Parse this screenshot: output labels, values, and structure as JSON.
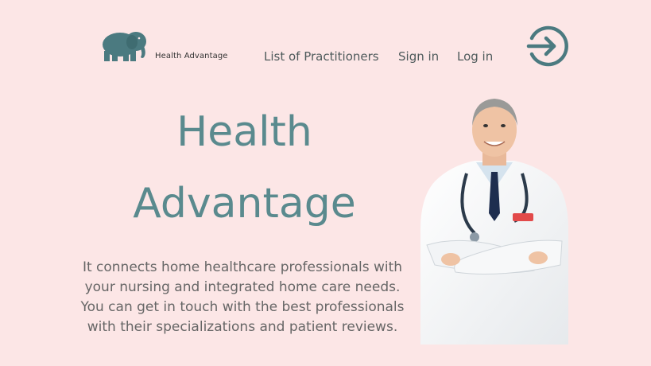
{
  "header": {
    "brand_name": "Health Advantage",
    "logo_icon": "elephant-icon",
    "nav": {
      "practitioners": "List of Practitioners",
      "sign_in": "Sign in",
      "log_in": "Log in"
    },
    "login_icon": "login-arrow-icon"
  },
  "hero": {
    "title_line1": "Health",
    "title_line2": "Advantage",
    "description": "It connects home healthcare professionals with your nursing and integrated home care needs. You can get in touch with the best professionals with their specializations and patient reviews.",
    "image": "doctor-photo"
  },
  "colors": {
    "background": "#fce6e6",
    "accent": "#5a8a8e",
    "logo": "#4b7a80"
  }
}
